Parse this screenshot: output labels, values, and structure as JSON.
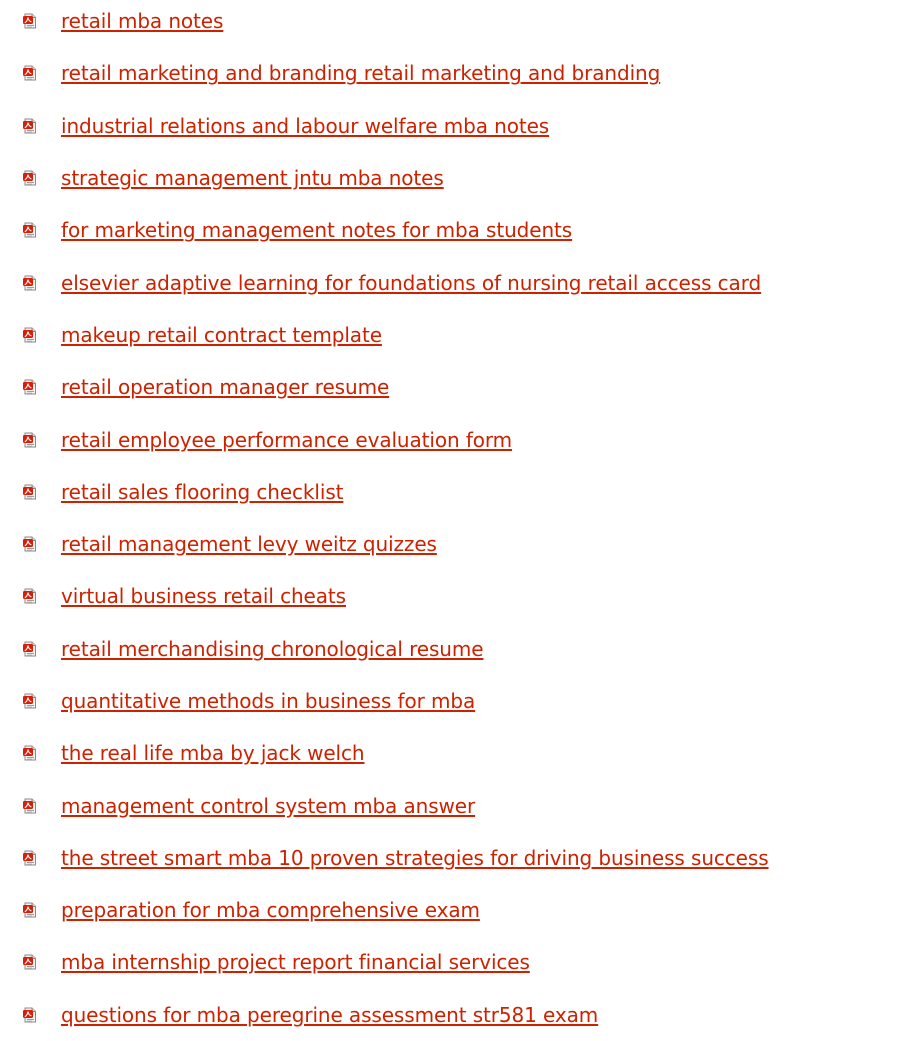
{
  "link_color": "#cc2200",
  "icon": "pdf-file-icon",
  "documents": [
    "retail mba notes",
    "retail marketing and branding retail marketing and branding",
    "industrial relations and labour welfare mba notes",
    "strategic management jntu mba notes",
    "for marketing management notes for mba students",
    "elsevier adaptive learning for foundations of nursing retail access card",
    "makeup retail contract template",
    "retail operation manager resume",
    "retail employee performance evaluation form",
    "retail sales flooring checklist",
    "retail management levy weitz quizzes",
    "virtual business retail cheats",
    "retail merchandising chronological resume",
    "quantitative methods in business for mba",
    "the real life mba by jack welch",
    "management control system mba answer",
    "the street smart mba 10 proven strategies for driving business success",
    "preparation for mba comprehensive exam",
    "mba internship project report financial services",
    "questions for mba peregrine assessment str581 exam"
  ]
}
